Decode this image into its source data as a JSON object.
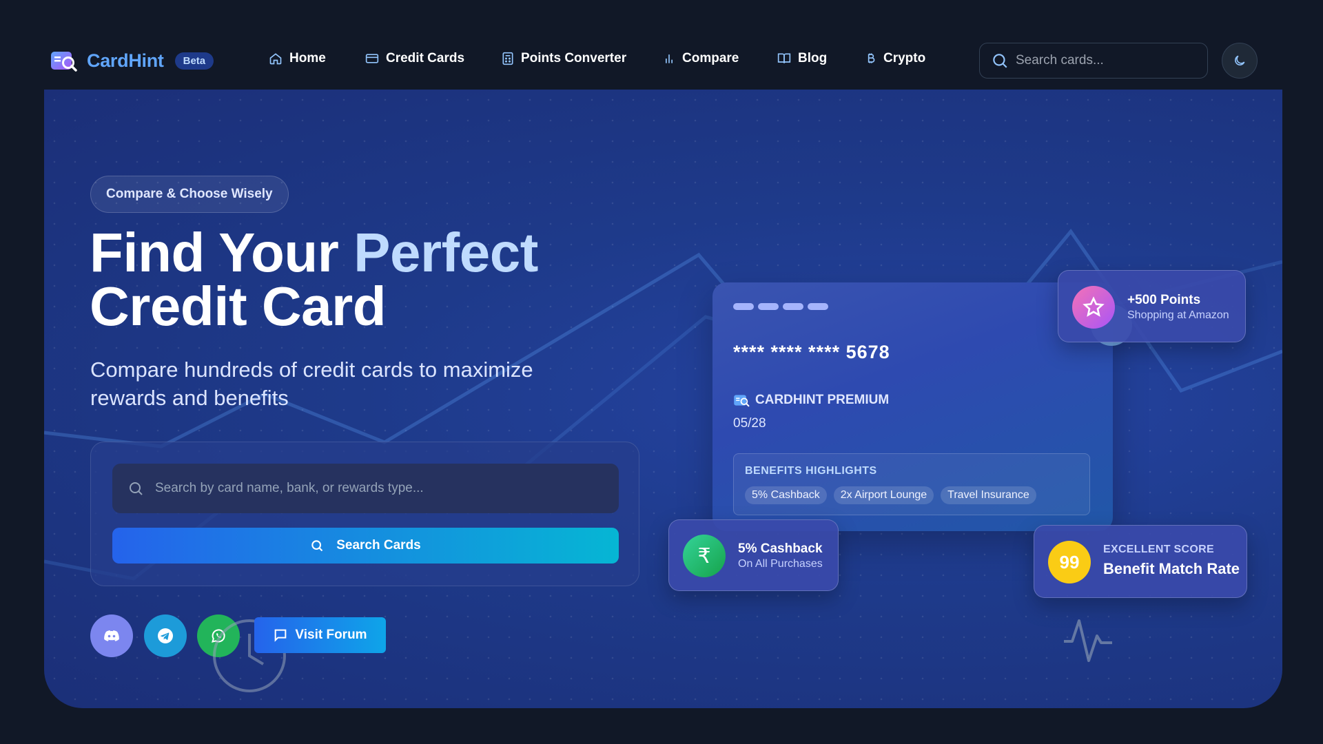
{
  "brand": {
    "name": "CardHint",
    "badge": "Beta"
  },
  "nav": {
    "items": [
      {
        "label": "Home",
        "icon": "home-icon"
      },
      {
        "label": "Credit Cards",
        "icon": "credit-card-icon"
      },
      {
        "label": "Points Converter",
        "icon": "calculator-icon"
      },
      {
        "label": "Compare",
        "icon": "bar-chart-icon"
      },
      {
        "label": "Blog",
        "icon": "book-icon"
      },
      {
        "label": "Crypto",
        "icon": "bitcoin-icon"
      }
    ],
    "search_placeholder": "Search cards...",
    "theme_icon": "moon-icon"
  },
  "hero": {
    "tagline": "Compare & Choose Wisely",
    "title_part1": "Find Your ",
    "title_accent": "Perfect",
    "title_line2": "Credit Card",
    "subtitle": "Compare hundreds of credit cards to maximize rewards and benefits",
    "search_placeholder": "Search by card name, bank, or rewards type...",
    "search_button": "Search Cards",
    "forum_button": "Visit Forum",
    "socials": [
      "discord-icon",
      "telegram-icon",
      "whatsapp-icon"
    ]
  },
  "card": {
    "number_masked": "**** **** ****",
    "number_last4": "5678",
    "name": "CARDHINT PREMIUM",
    "expiry": "05/28",
    "benefits_title": "BENEFITS HIGHLIGHTS",
    "benefits": [
      "5% Cashback",
      "2x Airport Lounge",
      "Travel Insurance"
    ]
  },
  "floating": {
    "points": {
      "title": "+500 Points",
      "subtitle": "Shopping at Amazon"
    },
    "cashback": {
      "title": "5% Cashback",
      "subtitle": "On All Purchases",
      "symbol": "₹"
    },
    "score": {
      "value": "99",
      "label": "EXCELLENT SCORE",
      "title": "Benefit Match Rate"
    }
  },
  "colors": {
    "page_bg": "#111827",
    "hero_bg": "#1e3a8a",
    "brand_blue": "#60a5fa",
    "button_gradient_start": "#2563eb",
    "button_gradient_end": "#06b6d4",
    "score_yellow": "#facc15"
  }
}
